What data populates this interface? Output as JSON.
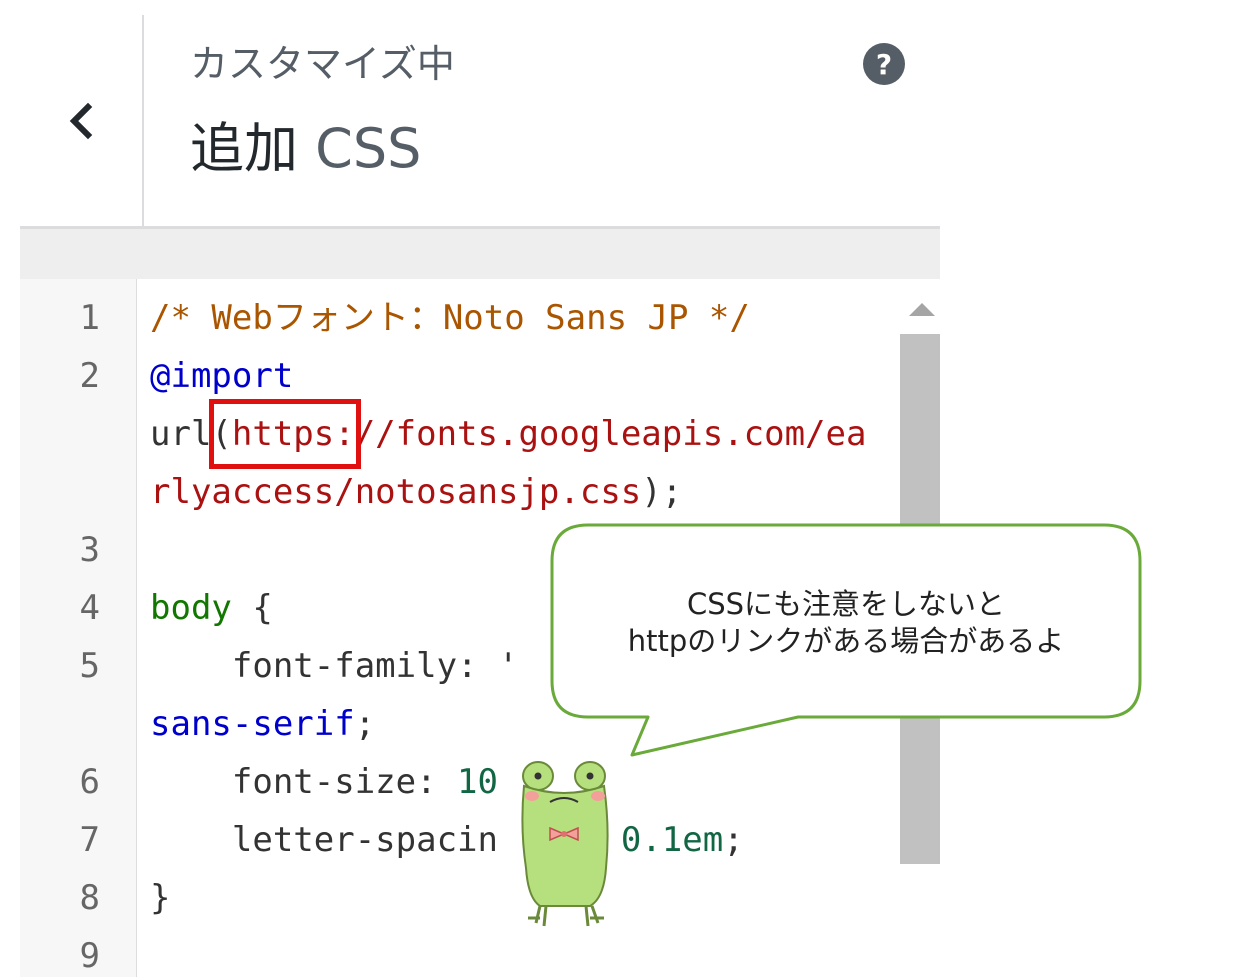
{
  "header": {
    "back_icon": "chevron-left-icon",
    "subtitle": "カスタマイズ中",
    "title_prefix": "追加",
    "title_suffix": "CSS",
    "help_label": "?"
  },
  "editor": {
    "lines": [
      {
        "num": "1",
        "tokens": [
          {
            "t": "/* Webフォント：Noto Sans JP */",
            "k": "comment"
          }
        ]
      },
      {
        "num": "2",
        "tokens": [
          {
            "t": "@import",
            "k": "kw"
          }
        ]
      },
      {
        "num": "",
        "tokens": [
          {
            "t": "url(",
            "k": "plain"
          },
          {
            "t": "https://fonts.googleapis.com/ea",
            "k": "str"
          }
        ]
      },
      {
        "num": "",
        "tokens": [
          {
            "t": "rlyaccess/notosansjp.css",
            "k": "str"
          },
          {
            "t": ");",
            "k": "plain"
          }
        ]
      },
      {
        "num": "3",
        "tokens": []
      },
      {
        "num": "4",
        "tokens": [
          {
            "t": "body",
            "k": "tag"
          },
          {
            "t": " {",
            "k": "plain"
          }
        ]
      },
      {
        "num": "5",
        "tokens": [
          {
            "t": "    font-family: '",
            "k": "plain"
          }
        ]
      },
      {
        "num": "",
        "tokens": [
          {
            "t": "sans-serif",
            "k": "kw"
          },
          {
            "t": ";",
            "k": "plain"
          }
        ]
      },
      {
        "num": "6",
        "tokens": [
          {
            "t": "    font-size: ",
            "k": "plain"
          },
          {
            "t": "10",
            "k": "num"
          }
        ]
      },
      {
        "num": "7",
        "tokens": [
          {
            "t": "    letter-spacin",
            "k": "plain"
          },
          {
            "t": "      ",
            "k": "plain"
          },
          {
            "t": "0.1em",
            "k": "num"
          },
          {
            "t": ";",
            "k": "plain"
          }
        ]
      },
      {
        "num": "8",
        "tokens": [
          {
            "t": "}",
            "k": "plain"
          }
        ]
      },
      {
        "num": "9",
        "tokens": []
      }
    ]
  },
  "callout": {
    "line1": "CSSにも注意をしないと",
    "line2": "httpのリンクがある場合があるよ"
  },
  "colors": {
    "highlight": "#e01010",
    "bubble_border": "#6aaa3a",
    "frog": "#b6df7e"
  }
}
